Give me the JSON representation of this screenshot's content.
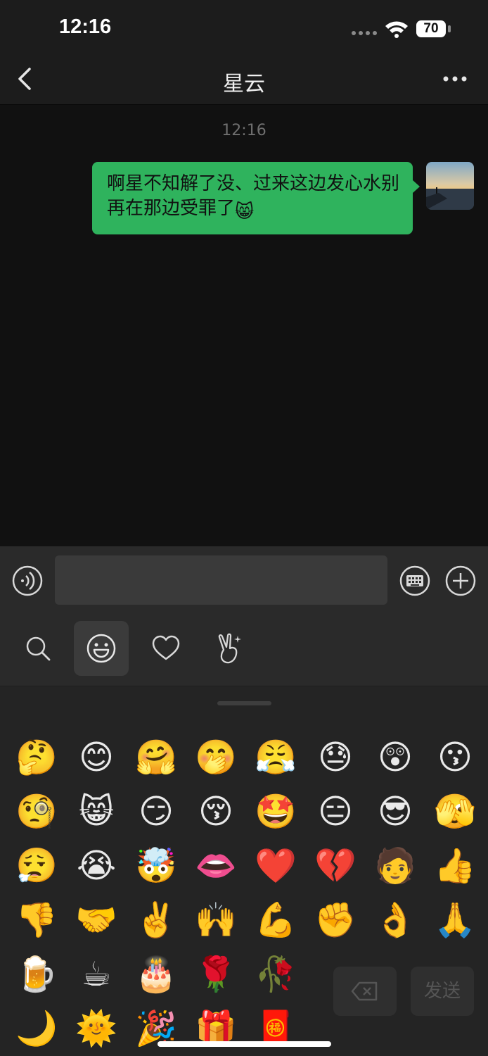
{
  "status_bar": {
    "time": "12:16",
    "battery": "70"
  },
  "nav": {
    "title": "星云"
  },
  "chat": {
    "timestamp": "12:16",
    "messages": [
      {
        "sender": "self",
        "text": "啊星不知解了没、过来这边发心水别再在那边受罪了",
        "trailing_emoji": "😸"
      }
    ]
  },
  "input": {
    "value": "",
    "placeholder": ""
  },
  "emoji_tabs": [
    {
      "name": "search",
      "icon": "search-icon"
    },
    {
      "name": "emoji",
      "icon": "smiley-icon",
      "active": true
    },
    {
      "name": "favorites",
      "icon": "heart-icon"
    },
    {
      "name": "stickers",
      "icon": "victory-hand-icon"
    }
  ],
  "emoji_panel": {
    "rows": [
      [
        "🤔",
        "😊",
        "🤗",
        "🤭",
        "😤",
        "😓",
        "😲",
        "😗"
      ],
      [
        "🧐",
        "😸",
        "😏",
        "😚",
        "🤩",
        "😑",
        "😎",
        "🫣"
      ],
      [
        "😮‍💨",
        "😭",
        "🤯",
        "👄",
        "❤️",
        "💔",
        "🧑",
        "👍"
      ],
      [
        "👎",
        "🤝",
        "✌️",
        "🙌",
        "💪",
        "✊",
        "👌",
        "🙏"
      ],
      [
        "🍺",
        "☕",
        "🎂",
        "🌹",
        "🥀"
      ],
      [
        "🌙",
        "🌞",
        "🎉",
        "🎁",
        "🧧"
      ]
    ],
    "send_label": "发送"
  },
  "colors": {
    "bubble": "#2fb35d",
    "background": "#111111",
    "panel": "#242424"
  }
}
